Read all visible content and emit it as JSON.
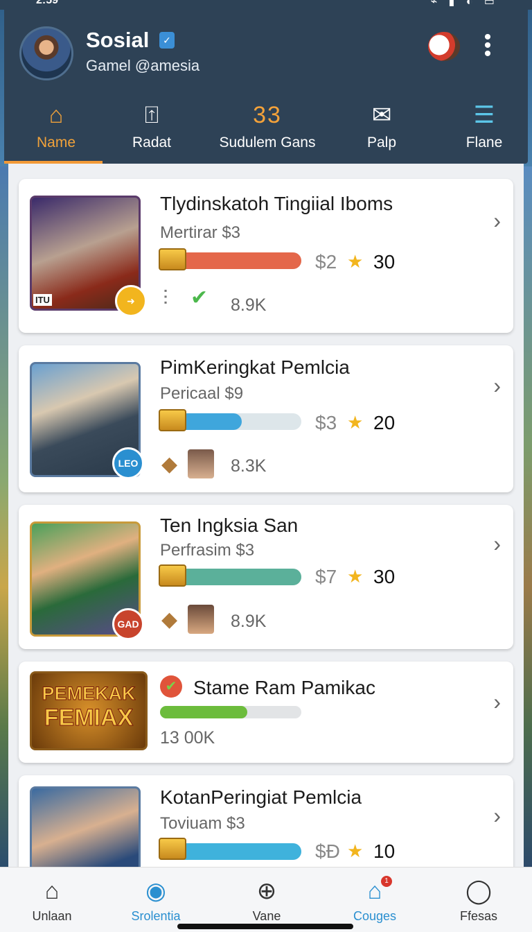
{
  "status": {
    "time": "2:59",
    "icons": "⌁ ▮ ◐ ▭"
  },
  "header": {
    "title": "Sosial",
    "subtitle": "Gamel @amesia",
    "verified_glyph": "✓"
  },
  "tabs": [
    {
      "label": "Name",
      "icon": "home-icon",
      "glyph": "⌂",
      "active": true
    },
    {
      "label": "Radat",
      "icon": "share-icon",
      "glyph": "⍐"
    },
    {
      "label": "Sudulem Gans",
      "count": "33"
    },
    {
      "label": "Palp",
      "icon": "mail-icon",
      "glyph": "✉"
    },
    {
      "label": "Flane",
      "icon": "list-icon",
      "glyph": "☰"
    }
  ],
  "cards": [
    {
      "title": "Tlydinskatoh Tingiial Iboms",
      "subtitle": "Mertirar $3",
      "progress": 1.0,
      "bar_color": "#e4674a",
      "price": "$2",
      "count": "30",
      "stat": "8.9K",
      "badge": "",
      "corner_label": "ITU"
    },
    {
      "title": "PimKeringkat Pemlcia",
      "subtitle": "Pericaal $9",
      "progress": 0.58,
      "bar_color": "#3fa6dc",
      "price": "$3",
      "count": "20",
      "stat": "8.3K",
      "badge": "LEO"
    },
    {
      "title": "Ten Ingksia San",
      "subtitle": "Perfrasim $3",
      "progress": 1.0,
      "bar_color": "#5bb09a",
      "price": "$7",
      "count": "30",
      "stat": "8.9K",
      "badge": "GAD"
    },
    {
      "title": "Stame Ram Pamikac",
      "progress": 0.62,
      "bar_color": "#6cbc3c",
      "stat": "13 00K",
      "thumb_text_1": "PEMEKAK",
      "thumb_text_2": "FEMIAX"
    },
    {
      "title": "KotanPeringiat Pemlcia",
      "subtitle": "Toviuam $3",
      "progress": 1.0,
      "bar_color": "#3fb2dc",
      "price": "$Ð",
      "count": "10"
    }
  ],
  "nav": [
    {
      "label": "Unlaan",
      "icon": "home-icon",
      "glyph": "⌂"
    },
    {
      "label": "Srolentia",
      "icon": "chat-icon",
      "glyph": "◉",
      "active": true
    },
    {
      "label": "Vane",
      "icon": "add-circle-icon",
      "glyph": "⊕"
    },
    {
      "label": "Couges",
      "icon": "bag-icon",
      "glyph": "⌂",
      "badge": "1"
    },
    {
      "label": "Ffesas",
      "icon": "profile-icon",
      "glyph": "◯"
    }
  ],
  "colors": {
    "header_bg": "#2e4256",
    "accent": "#f29a37",
    "active_nav": "#2a8fd0"
  }
}
